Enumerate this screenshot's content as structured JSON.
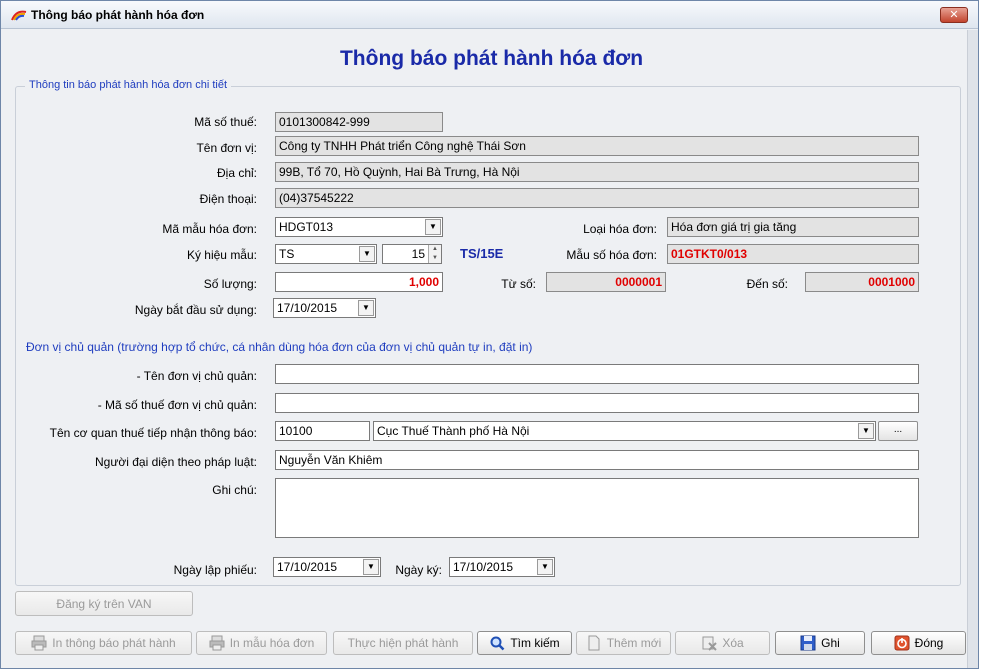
{
  "window": {
    "title": "Thông báo phát hành hóa đơn",
    "close_label": "✕"
  },
  "heading": "Thông báo phát hành hóa đơn",
  "detail_group": {
    "legend": "Thông tin báo phát hành hóa đơn chi tiết"
  },
  "labels": {
    "tax_code": "Mã số thuế:",
    "unit_name": "Tên đơn vị:",
    "address": "Địa chỉ:",
    "phone": "Điện thoại:",
    "template_code": "Mã mẫu hóa đơn:",
    "invoice_type": "Loại hóa đơn:",
    "symbol": "Ký hiệu mẫu:",
    "template_number": "Mẫu số hóa đơn:",
    "quantity": "Số lượng:",
    "from_no": "Từ số:",
    "to_no": "Đến số:",
    "start_date": "Ngày bắt đầu sử dụng:",
    "parent_note": "Đơn vị chủ quản (trường hợp tổ chức, cá nhân dùng hóa đơn của đơn vị chủ quản tự in, đặt in)",
    "parent_name": "- Tên đơn vị chủ quản:",
    "parent_tax": "- Mã số thuế đơn vị chủ quản:",
    "tax_office": "Tên cơ quan thuế tiếp nhận thông báo:",
    "representative": "Người đại diện theo pháp luật:",
    "note": "Ghi chú:",
    "created_date": "Ngày lập phiếu:",
    "sign_date": "Ngày ký:"
  },
  "values": {
    "tax_code": "0101300842-999",
    "unit_name": "Công ty TNHH Phát triển Công nghệ Thái Sơn",
    "address": "99B, Tổ 70, Hồ Quỳnh, Hai Bà Trưng, Hà Nội",
    "phone": "(04)37545222",
    "template_code": "HDGT013",
    "invoice_type": "Hóa đơn giá trị gia tăng",
    "symbol": "TS",
    "year": "15",
    "symbol_full": "TS/15E",
    "template_number": "01GTKT0/013",
    "quantity": "1,000",
    "from_no": "0000001",
    "to_no": "0001000",
    "start_date": "17/10/2015",
    "parent_name": "",
    "parent_tax": "",
    "tax_office_code": "10100",
    "tax_office_name": "Cục Thuế Thành phố Hà Nội",
    "representative": "Nguyễn Văn Khiêm",
    "note": "",
    "created_date": "17/10/2015",
    "sign_date": "17/10/2015"
  },
  "buttons": {
    "register_van": "Đăng ký trên VAN",
    "print_notice": "In thông báo phát hành",
    "print_template": "In mẫu hóa đơn",
    "execute": "Thực hiện phát hành",
    "search": "Tìm kiếm",
    "add_new": "Thêm mới",
    "delete": "Xóa",
    "save": "Ghi",
    "close": "Đóng",
    "ellipsis": "..."
  }
}
